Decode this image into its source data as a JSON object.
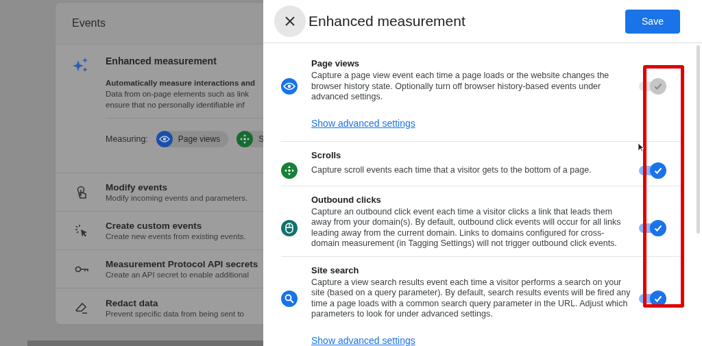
{
  "background": {
    "card_title": "Events",
    "enhanced": {
      "title": "Enhanced measurement",
      "description": [
        "Automatically measure interactions and",
        "Data from on-page elements such as link",
        "ensure that no personally identifiable inf"
      ],
      "measuring_label": "Measuring:",
      "chips": [
        {
          "label": "Page views"
        },
        {
          "label": "S"
        }
      ]
    },
    "items": [
      {
        "title": "Modify events",
        "subtitle": "Modify incoming events and parameters."
      },
      {
        "title": "Create custom events",
        "subtitle": "Create new events from existing events."
      },
      {
        "title": "Measurement Protocol API secrets",
        "subtitle": "Create an API secret to enable additional"
      },
      {
        "title": "Redact data",
        "subtitle": "Prevent specific data from being sent to"
      }
    ]
  },
  "drawer": {
    "title": "Enhanced measurement",
    "save_button": "Save",
    "settings": [
      {
        "title": "Page views",
        "description": "Capture a page view event each time a page loads or the website changes the browser history state. Optionally turn off browser history-based events under advanced settings.",
        "link": "Show advanced settings",
        "on": true,
        "disabled": true
      },
      {
        "title": "Scrolls",
        "description": "Capture scroll events each time that a visitor gets to the bottom of a page.",
        "on": true,
        "disabled": false
      },
      {
        "title": "Outbound clicks",
        "description": "Capture an outbound click event each time a visitor clicks a link that leads them away from your domain(s). By default, outbound click events will occur for all links leading away from the current domain. Links to domains configured for cross-domain measurement (in Tagging Settings) will not trigger outbound click events.",
        "on": true,
        "disabled": false
      },
      {
        "title": "Site search",
        "description": "Capture a view search results event each time a visitor performs a search on your site (based on a query parameter). By default, search results events will be fired any time a page loads with a common search query parameter in the URL. Adjust which parameters to look for under advanced settings.",
        "link": "Show advanced settings",
        "on": true,
        "disabled": false
      }
    ]
  }
}
